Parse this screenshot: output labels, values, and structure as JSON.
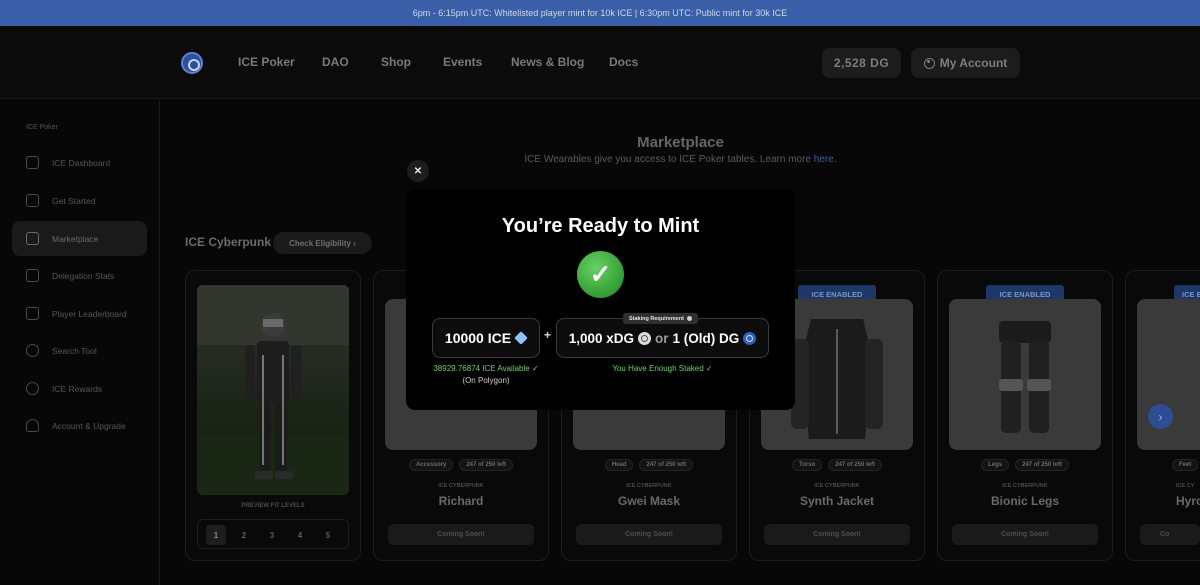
{
  "banner": {
    "text": "6pm - 6:15pm UTC: Whitelisted player mint for 10k ICE | 6:30pm UTC: Public mint for 30k ICE"
  },
  "nav": {
    "links": [
      "ICE Poker",
      "DAO",
      "Shop",
      "Events",
      "News & Blog",
      "Docs"
    ],
    "balance": "2,528 DG",
    "account": "My Account"
  },
  "sidebar": {
    "section": "ICE Poker",
    "items": [
      {
        "label": "ICE Dashboard",
        "icon": "home-icon"
      },
      {
        "label": "Get Started",
        "icon": "thumbs-up-icon"
      },
      {
        "label": "Marketplace",
        "icon": "shopping-bag-icon",
        "active": true
      },
      {
        "label": "Delegation Stats",
        "icon": "table-icon"
      },
      {
        "label": "Player Leaderboard",
        "icon": "bar-chart-icon"
      },
      {
        "label": "Search Tool",
        "icon": "search-icon"
      },
      {
        "label": "ICE Rewards",
        "icon": "award-icon"
      },
      {
        "label": "Account & Upgrade",
        "icon": "user-icon"
      }
    ]
  },
  "main": {
    "title": "Marketplace",
    "subtitle": "ICE Wearables give you access to ICE Poker tables. Learn more",
    "subtitle_link": "here.",
    "collection": "ICE Cyberpunk",
    "eligibility_button": "Check Eligibility ›",
    "preview_label": "PREVIEW FIT LEVELS",
    "levels": [
      "1",
      "2",
      "3",
      "4",
      "5"
    ],
    "cards": [
      {
        "slot": "Accessory",
        "left": "247 of 250 left",
        "set": "ICE CYBERPUNK",
        "name": "Richard",
        "button": "Coming Soon!",
        "enabled": ""
      },
      {
        "slot": "Head",
        "left": "247 of 250 left",
        "set": "ICE CYBERPUNK",
        "name": "Gwei Mask",
        "button": "Coming Soon!",
        "enabled": ""
      },
      {
        "slot": "Torso",
        "left": "247 of 250 left",
        "set": "ICE CYBERPUNK",
        "name": "Synth Jacket",
        "button": "Coming Soon!",
        "enabled": "ICE ENABLED"
      },
      {
        "slot": "Legs",
        "left": "247 of 250 left",
        "set": "ICE CYBERPUNK",
        "name": "Bionic Legs",
        "button": "Coming Soon!",
        "enabled": "ICE ENABLED"
      },
      {
        "slot": "Feet",
        "left": "",
        "set": "ICE CY",
        "name": "Hyro",
        "button": "Co",
        "enabled": "ICE E"
      }
    ]
  },
  "modal": {
    "title": "You’re Ready to Mint",
    "ice_amount": "10000 ICE",
    "plus": "+",
    "staking_tag": "Staking Requirement",
    "stake_xdg": "1,000 xDG",
    "or": "or",
    "stake_dg": "1 (Old) DG",
    "ice_available": "38929.76874 ICE Available ✓",
    "network": "(On Polygon)",
    "staked_status": "You Have Enough Staked ✓",
    "close": "✕"
  }
}
